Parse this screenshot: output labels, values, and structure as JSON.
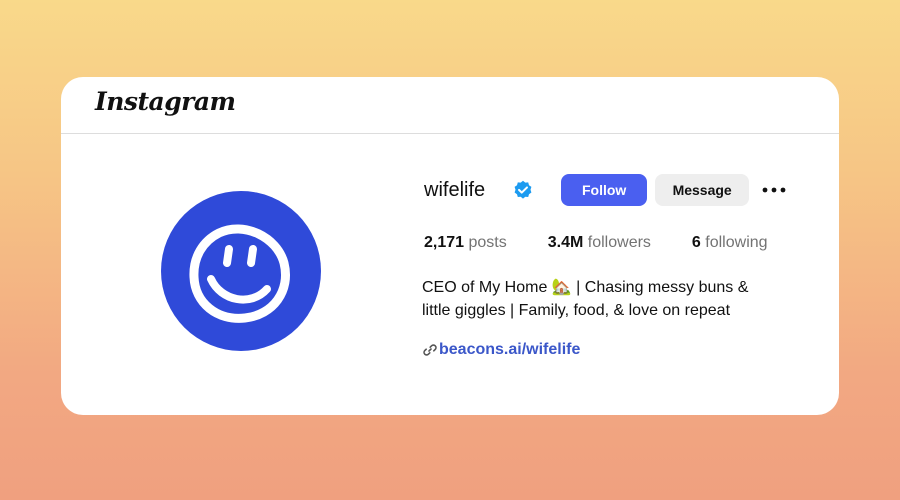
{
  "header": {
    "logo_text": "Instagram"
  },
  "profile": {
    "username": "wifelife",
    "verified": true,
    "follow_label": "Follow",
    "message_label": "Message",
    "stats": {
      "posts_count": "2,171",
      "posts_label": "posts",
      "followers_count": "3.4M",
      "followers_label": "followers",
      "following_count": "6",
      "following_label": "following"
    },
    "bio_line1": "CEO of My Home 🏡 | Chasing messy buns &",
    "bio_line2": "little giggles | Family, food, & love on repeat",
    "link": "beacons.ai/wifelife"
  },
  "colors": {
    "brand_blue": "#4a5ff0",
    "avatar_blue": "#2f4ad9",
    "verified_blue": "#1d9bf0",
    "link_blue": "#3b57c9"
  },
  "icons": {
    "avatar": "smiley-face-icon",
    "verified": "verified-badge-icon",
    "more": "more-horizontal-icon",
    "link": "link-icon"
  }
}
